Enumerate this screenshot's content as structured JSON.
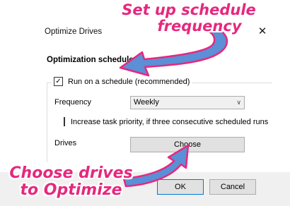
{
  "window": {
    "title": "Optimize Drives",
    "close_icon": "close-icon"
  },
  "schedule": {
    "section_title": "Optimization schedule",
    "run_on_schedule_label": "Run on a schedule (recommended)",
    "run_on_schedule_checked": true,
    "frequency_label": "Frequency",
    "frequency_value": "Weekly",
    "priority_label": "Increase task priority, if three consecutive scheduled runs are m",
    "priority_checked": false,
    "drives_label": "Drives",
    "choose_button": "Choose"
  },
  "footer": {
    "ok_label": "OK",
    "cancel_label": "Cancel"
  },
  "annotations": {
    "top": "Set up schedule frequency",
    "bottom": "Choose drives to Optimize",
    "text_color": "#e6287e",
    "arrow_color": "#5b8fd6"
  }
}
